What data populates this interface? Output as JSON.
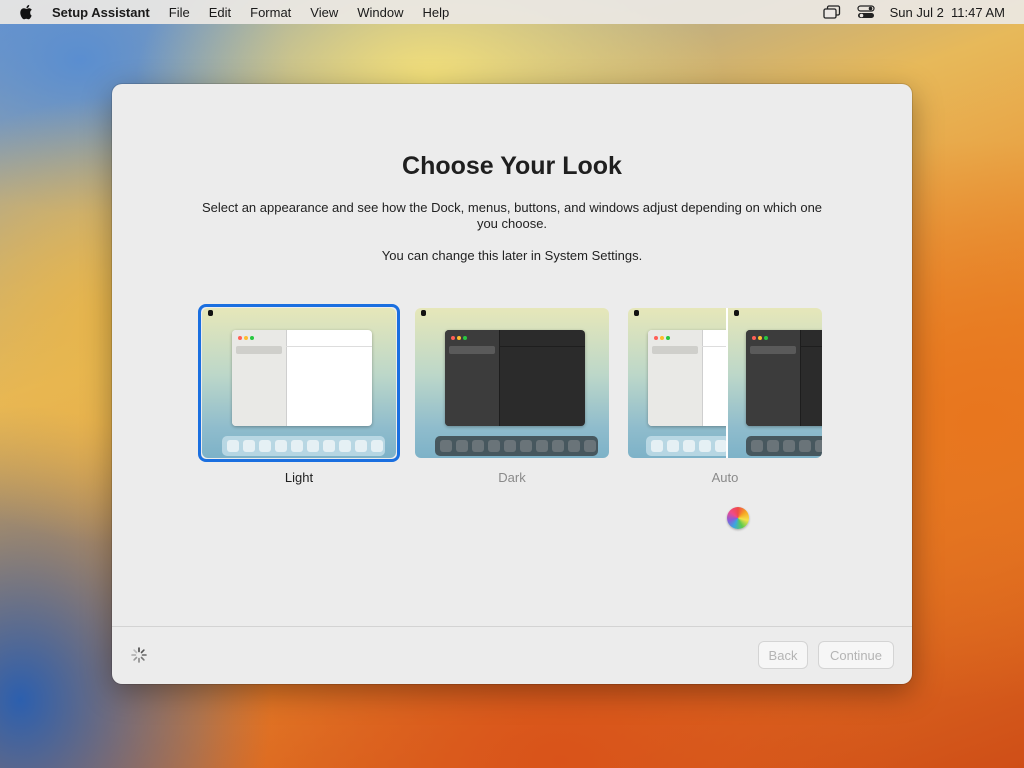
{
  "menubar": {
    "app_name": "Setup Assistant",
    "items": [
      "File",
      "Edit",
      "Format",
      "View",
      "Window",
      "Help"
    ],
    "datetime": "Sun Jul 2  11:47 AM",
    "icons": [
      "apple-icon",
      "screen-mirroring-icon",
      "control-center-icon"
    ]
  },
  "window": {
    "title": "Choose Your Look",
    "description": "Select an appearance and see how the Dock, menus, buttons, and windows adjust depending on which one you choose.",
    "note": "You can change this later in System Settings.",
    "options": [
      {
        "label": "Light",
        "selected": true
      },
      {
        "label": "Dark",
        "selected": false
      },
      {
        "label": "Auto",
        "selected": false
      }
    ],
    "buttons": {
      "back": "Back",
      "continue": "Continue"
    },
    "accent_color": "#1a6fe0"
  }
}
